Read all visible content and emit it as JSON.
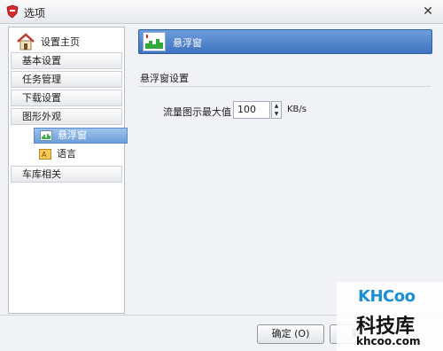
{
  "window": {
    "title": "选项"
  },
  "sidebar": {
    "home": {
      "label": "设置主页",
      "icon": "house-icon"
    },
    "items": [
      {
        "label": "基本设置"
      },
      {
        "label": "任务管理"
      },
      {
        "label": "下载设置"
      },
      {
        "label": "图形外观"
      },
      {
        "label": "车库相关"
      }
    ],
    "sub_items": [
      {
        "label": "悬浮窗",
        "icon": "float-window-icon",
        "selected": true
      },
      {
        "label": "语言",
        "icon": "language-icon",
        "selected": false
      }
    ]
  },
  "content": {
    "header_title": "悬浮窗",
    "section_title": "悬浮窗设置",
    "fields": {
      "max_flow_label": "流量图示最大值",
      "max_flow_value": "100",
      "max_flow_unit": "KB/s"
    }
  },
  "footer": {
    "ok_label": "确定 (O)",
    "cancel_label": "取"
  },
  "watermark": {
    "brand": "KHCoo",
    "chinese": "科技库",
    "url": "khcoo.com"
  },
  "colors": {
    "header_blue": "#4a7ec9",
    "selected_blue": "#7ba9dd"
  }
}
